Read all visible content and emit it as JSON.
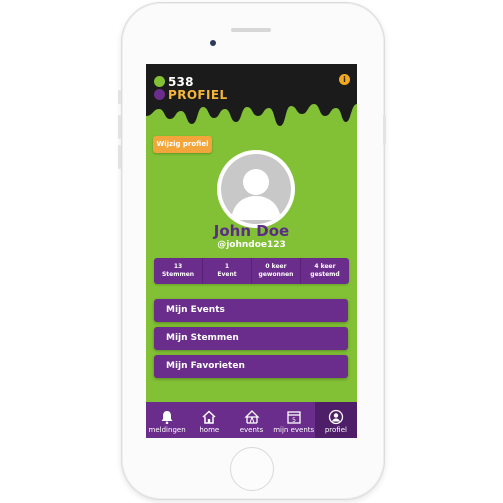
{
  "app": {
    "logo_number": "538",
    "logo_word": "PROFIEL",
    "info_glyph": "i"
  },
  "colors": {
    "green": "#82c135",
    "purple": "#6b2d8b",
    "dark_purple": "#4e1e69",
    "orange": "#f2a53a",
    "black_drip": "#1b1b1b"
  },
  "profile": {
    "edit_label": "Wijzig profiel",
    "name": "John Doe",
    "handle": "@johndoe123",
    "avatar_icon": "user-silhouette-icon"
  },
  "stats": [
    {
      "value": "13",
      "label": "Stemmen"
    },
    {
      "value": "1",
      "label": "Event"
    },
    {
      "value": "0 keer",
      "label": "gewonnen"
    },
    {
      "value": "4 keer",
      "label": "gestemd"
    }
  ],
  "menu": {
    "events": "Mijn Events",
    "stemmen": "Mijn Stemmen",
    "favorieten": "Mijn Favorieten"
  },
  "tabs": [
    {
      "label": "meldingen",
      "icon": "bell-icon"
    },
    {
      "label": "home",
      "icon": "home-icon"
    },
    {
      "label": "events",
      "icon": "tent-icon"
    },
    {
      "label": "mijn events",
      "icon": "calendar-icon"
    },
    {
      "label": "profiel",
      "icon": "profile-icon",
      "active": true
    }
  ]
}
